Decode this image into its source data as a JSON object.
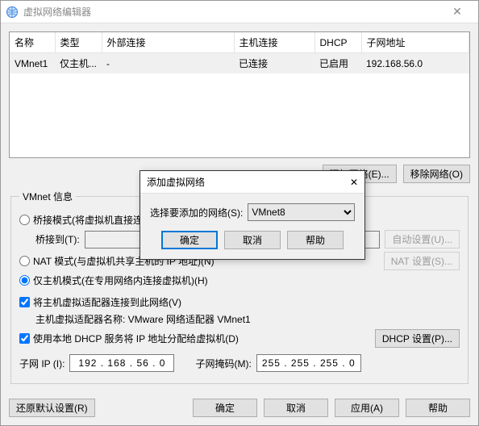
{
  "window": {
    "title": "虚拟网络编辑器",
    "close": "✕"
  },
  "table": {
    "headers": {
      "name": "名称",
      "type": "类型",
      "external": "外部连接",
      "host": "主机连接",
      "dhcp": "DHCP",
      "subnet": "子网地址"
    },
    "rows": [
      {
        "name": "VMnet1",
        "type": "仅主机...",
        "external": "-",
        "host": "已连接",
        "dhcp": "已启用",
        "subnet": "192.168.56.0"
      }
    ]
  },
  "buttons": {
    "add_net": "添加网络(E)...",
    "remove_net": "移除网络(O)",
    "auto_set": "自动设置(U)...",
    "nat_set": "NAT 设置(S)...",
    "dhcp_set": "DHCP 设置(P)...",
    "restore": "还原默认设置(R)",
    "ok": "确定",
    "cancel": "取消",
    "apply": "应用(A)",
    "help": "帮助"
  },
  "info": {
    "legend": "VMnet 信息",
    "bridge": "桥接模式(将虚拟机直接连接到外部网络)(B)",
    "bridge_to": "桥接到(T):",
    "nat": "NAT 模式(与虚拟机共享主机的 IP 地址)(N)",
    "hostonly": "仅主机模式(在专用网络内连接虚拟机)(H)",
    "connect_host": "将主机虚拟适配器连接到此网络(V)",
    "adapter_label": "主机虚拟适配器名称: VMware 网络适配器 VMnet1",
    "use_dhcp": "使用本地 DHCP 服务将 IP 地址分配给虚拟机(D)",
    "subnet_ip_label": "子网 IP (I):",
    "subnet_ip": "192 . 168 . 56 . 0",
    "subnet_mask_label": "子网掩码(M):",
    "subnet_mask": "255 . 255 . 255 . 0"
  },
  "dialog": {
    "title": "添加虚拟网络",
    "close": "✕",
    "select_label": "选择要添加的网络(S):",
    "selected": "VMnet8",
    "ok": "确定",
    "cancel": "取消",
    "help": "帮助"
  }
}
